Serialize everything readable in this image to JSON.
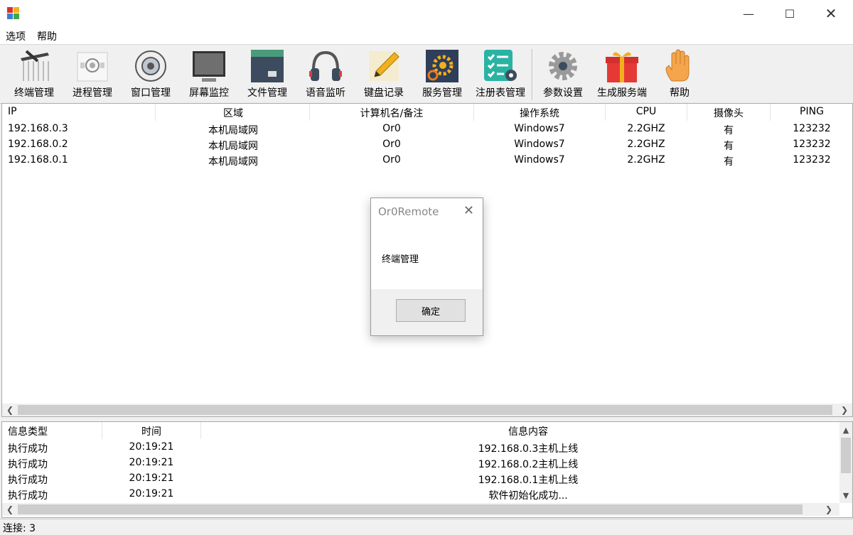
{
  "menu": {
    "options": "选项",
    "help": "帮助"
  },
  "toolbar": {
    "items": [
      {
        "label": "终端管理",
        "icon": "terminal-icon"
      },
      {
        "label": "进程管理",
        "icon": "process-icon"
      },
      {
        "label": "窗口管理",
        "icon": "window-icon"
      },
      {
        "label": "屏幕监控",
        "icon": "monitor-icon"
      },
      {
        "label": "文件管理",
        "icon": "folder-icon"
      },
      {
        "label": "语音监听",
        "icon": "headphones-icon"
      },
      {
        "label": "键盘记录",
        "icon": "pencil-icon"
      },
      {
        "label": "服务管理",
        "icon": "gears-icon"
      },
      {
        "label": "注册表管理",
        "icon": "checklist-icon"
      },
      {
        "label": "参数设置",
        "icon": "gear-icon"
      },
      {
        "label": "生成服务端",
        "icon": "gift-icon"
      },
      {
        "label": "帮助",
        "icon": "hand-icon"
      }
    ]
  },
  "hosts": {
    "columns": [
      "IP",
      "区域",
      "计算机名/备注",
      "操作系统",
      "CPU",
      "摄像头",
      "PING"
    ],
    "rows": [
      [
        "192.168.0.3",
        "本机局域网",
        "Or0",
        "Windows7",
        "2.2GHZ",
        "有",
        "123232"
      ],
      [
        "192.168.0.2",
        "本机局域网",
        "Or0",
        "Windows7",
        "2.2GHZ",
        "有",
        "123232"
      ],
      [
        "192.168.0.1",
        "本机局域网",
        "Or0",
        "Windows7",
        "2.2GHZ",
        "有",
        "123232"
      ]
    ]
  },
  "log": {
    "columns": [
      "信息类型",
      "时间",
      "信息内容"
    ],
    "rows": [
      [
        "执行成功",
        "20:19:21",
        "192.168.0.3主机上线"
      ],
      [
        "执行成功",
        "20:19:21",
        "192.168.0.2主机上线"
      ],
      [
        "执行成功",
        "20:19:21",
        "192.168.0.1主机上线"
      ],
      [
        "执行成功",
        "20:19:21",
        "软件初始化成功..."
      ]
    ]
  },
  "status": {
    "text": "连接: 3"
  },
  "dialog": {
    "title": "Or0Remote",
    "message": "终端管理",
    "ok": "确定"
  }
}
